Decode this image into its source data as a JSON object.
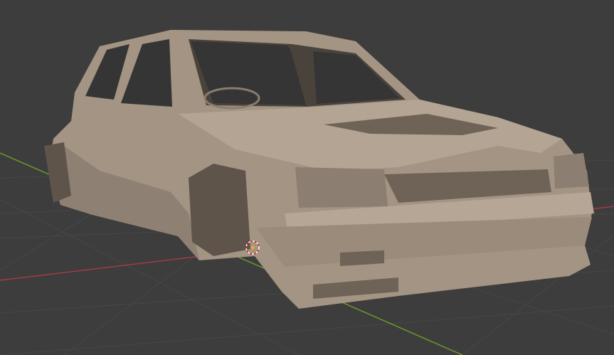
{
  "viewport": {
    "background_color": "#3d3d3d",
    "grid_color": "#474747",
    "x_axis_color": "#a23b45",
    "y_axis_color": "#6c9a2a",
    "model_color": "#a39483",
    "model_shadow_color": "#6f6357",
    "window_color": "#353535",
    "icons": {
      "cursor": "3d-cursor-icon",
      "origin": "object-origin-icon"
    }
  }
}
